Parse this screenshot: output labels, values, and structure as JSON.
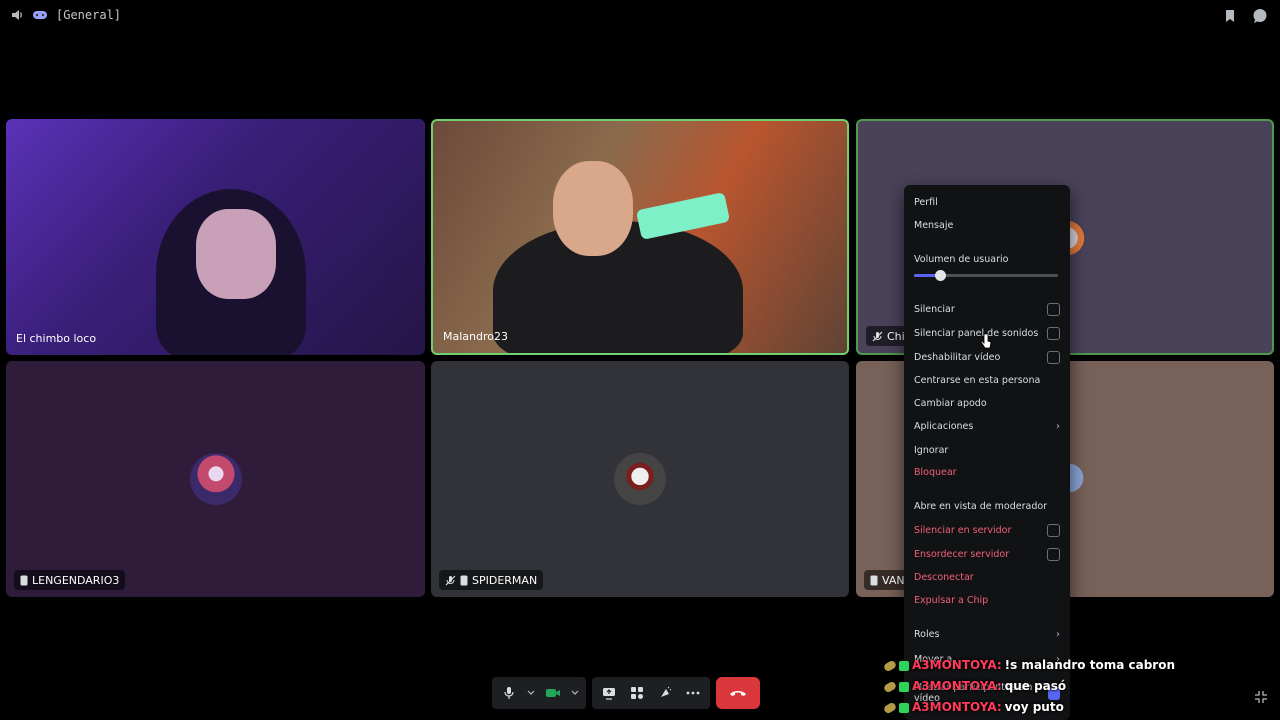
{
  "topbar": {
    "channel_name": "[General]",
    "icons": [
      "speaker-icon",
      "game-controller-icon",
      "bookmark-icon",
      "chat-bubble-icon"
    ]
  },
  "participants": [
    {
      "name": "El chimbo loco",
      "icon": null,
      "muted": false
    },
    {
      "name": "Malandro23",
      "icon": null,
      "muted": false,
      "speaking": true
    },
    {
      "name": "Chip",
      "icon": "mic-off-icon",
      "muted": true
    },
    {
      "name": "LENGENDARIO3",
      "icon": "mobile-icon",
      "muted": false
    },
    {
      "name": "SPIDERMAN",
      "icon": "mobile-icon",
      "muted": true
    },
    {
      "name": "VANE",
      "icon": "mobile-icon",
      "muted": false
    }
  ],
  "context_menu": {
    "profile": "Perfil",
    "message": "Mensaje",
    "user_volume_label": "Volumen de usuario",
    "user_volume_value": 0.18,
    "mute": "Silenciar",
    "mute_soundboard": "Silenciar panel de sonidos",
    "disable_video": "Deshabilitar vídeo",
    "focus_person": "Centrarse en esta persona",
    "change_nickname": "Cambiar apodo",
    "apps": "Aplicaciones",
    "ignore": "Ignorar",
    "block": "Bloquear",
    "moderator_view": "Abre en vista de moderador",
    "server_mute": "Silenciar en servidor",
    "server_deafen": "Ensordecer servidor",
    "disconnect": "Desconectar",
    "kick": "Expulsar a Chip",
    "roles": "Roles",
    "move_to": "Mover a",
    "show_non_video": "Mostrar participantes sin vídeo"
  },
  "chat_overlay": [
    {
      "user": "A3MONTOYA:",
      "message": "!s malandro toma cabron"
    },
    {
      "user": "A3MONTOYA:",
      "message": "que pasó"
    },
    {
      "user": "A3MONTOYA:",
      "message": "voy puto"
    }
  ],
  "colors": {
    "accent": "#5865f2",
    "danger": "#f0607a",
    "hangup": "#da373c",
    "speaking": "#6fd06f",
    "chat_user": "#ff3a5a"
  }
}
